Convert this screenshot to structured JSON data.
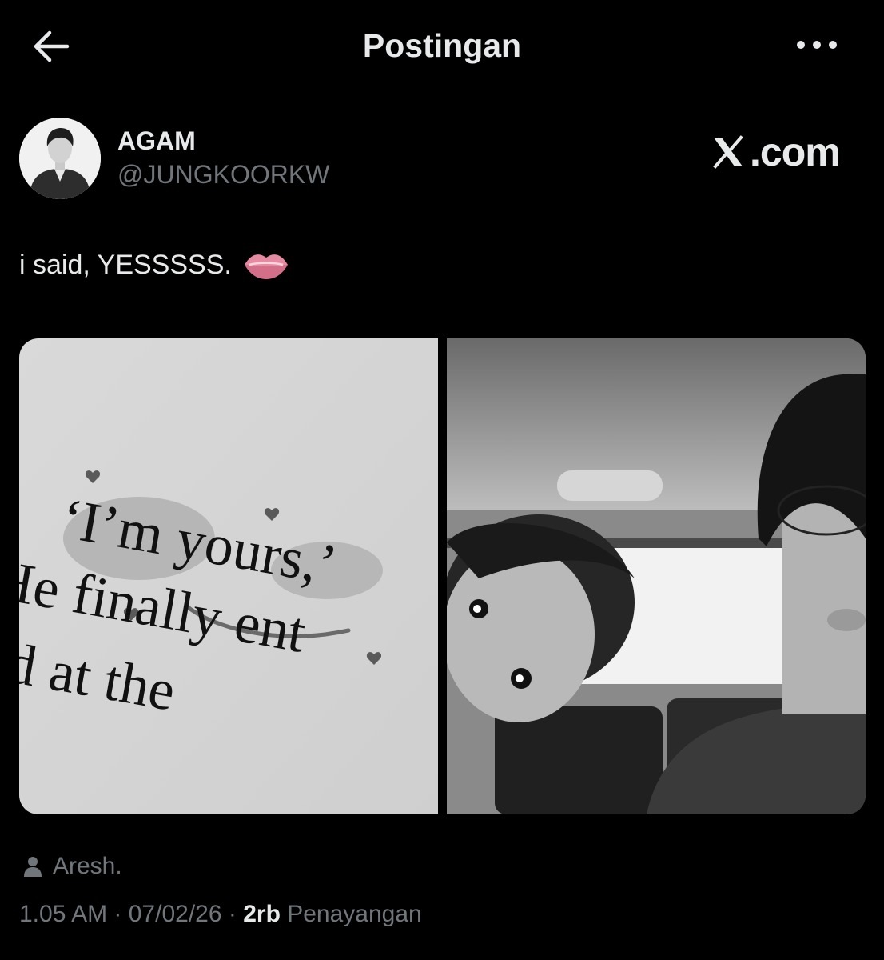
{
  "header": {
    "title": "Postingan",
    "back_icon": "arrow-left-icon",
    "more_icon": "more-horizontal-icon"
  },
  "author": {
    "display_name": "AGAM",
    "handle": "@JUNGKOORKW",
    "avatar_icon": "avatar-photo"
  },
  "watermark": {
    "label": ".com",
    "icon": "x-logo-icon"
  },
  "tweet": {
    "text": "i said, YESSSSS.",
    "emoji": "lips-emoji-icon"
  },
  "media": {
    "left_image": {
      "line1": "‘I’m yours,’",
      "line2": "He finally ent",
      "line3": "ped at the"
    },
    "right_image": {}
  },
  "tagged_user": {
    "name": "Aresh.",
    "icon": "person-icon"
  },
  "meta": {
    "time": "1.05 AM",
    "separator": " · ",
    "date": "07/02/26",
    "views_count": "2rb",
    "views_label": " Penayangan"
  },
  "colors": {
    "background": "#000000",
    "text_primary": "#e7e9ea",
    "text_secondary": "#71767b"
  }
}
